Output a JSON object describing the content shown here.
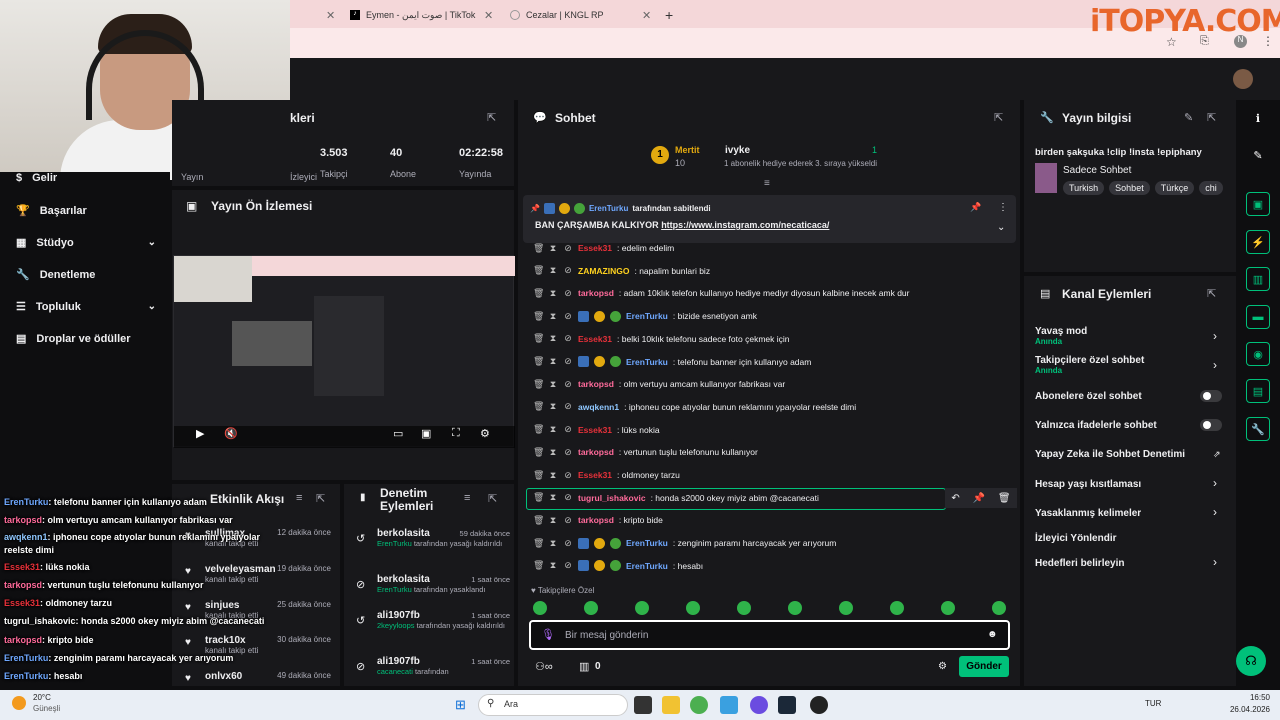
{
  "browser": {
    "tabs": [
      {
        "label": "Eymen - صوت ايمن | TikTok"
      },
      {
        "label": "Cezalar | KNGL RP"
      }
    ],
    "watermark": "iTOPYA.COM"
  },
  "sidebar": {
    "items": [
      {
        "label": "Gelir"
      },
      {
        "label": "Başarılar"
      },
      {
        "label": "Stüdyo"
      },
      {
        "label": "Denetleme"
      },
      {
        "label": "Topluluk"
      },
      {
        "label": "Droplar ve ödüller"
      }
    ]
  },
  "stats": {
    "title": "kleri",
    "items": [
      {
        "value": "3.503",
        "label": "Takipçi"
      },
      {
        "value": "40",
        "label": "Abone"
      },
      {
        "value": "02:22:58",
        "label": "Yayında"
      }
    ],
    "left_label": "Yayın",
    "left2": "İzleyici"
  },
  "preview": {
    "title": "Yayın Ön İzlemesi"
  },
  "activity": {
    "title": "Etkinlik Akışı",
    "items": [
      {
        "name": "sullimax",
        "text": "kanalı takip etti",
        "time": "12 dakika önce"
      },
      {
        "name": "velveleyasman",
        "text": "kanalı takip etti",
        "time": "19 dakika önce"
      },
      {
        "name": "sinjues",
        "text": "kanalı takip etti",
        "time": "25 dakika önce"
      },
      {
        "name": "track10x",
        "text": "kanalı takip etti",
        "time": "30 dakika önce"
      },
      {
        "name": "onlvx60",
        "text": "",
        "time": "49 dakika önce"
      }
    ]
  },
  "moderation": {
    "title": "Denetim Eylemleri",
    "items": [
      {
        "name": "berkolasita",
        "time": "59 dakika önce",
        "actor": "ErenTurku",
        "text": "tarafından yasağı kaldırıldı"
      },
      {
        "name": "berkolasita",
        "time": "1 saat önce",
        "actor": "ErenTurku",
        "text": "tarafından yasaklandı"
      },
      {
        "name": "ali1907fb",
        "time": "1 saat önce",
        "actor": "2keyyloops",
        "text": "tarafından yasağı kaldırıldı"
      },
      {
        "name": "ali1907fb",
        "time": "1 saat önce",
        "actor": "cacanecati",
        "text": "tarafından"
      }
    ]
  },
  "chat": {
    "title": "Sohbet",
    "gift": {
      "user1": "Mertit",
      "count1": "10",
      "user2": "ivyke",
      "count2": "1",
      "text": "1 abonelik hediye ederek 3. sıraya yükseldi"
    },
    "pinned": {
      "by": "ErenTurku",
      "by_text": "tarafından sabitlendi",
      "text": "BAN ÇARŞAMBA KALKIYOR",
      "link": "https://www.instagram.com/necaticaca/"
    },
    "messages": [
      {
        "user": "Essek31",
        "color": "#e8313a",
        "text": ": edelim edelim"
      },
      {
        "user": "ZAMAZINGO",
        "color": "#ffd21f",
        "text": ": napalim bunlari biz"
      },
      {
        "user": "tarkopsd",
        "color": "#ff6b9b",
        "text": ": adam 10klık telefon kullanıyo hediye mediyr diyosun kalbine inecek amk dur"
      },
      {
        "user": "ErenTurku",
        "color": "#6fa8ff",
        "text": ": bizide esnetiyon amk"
      },
      {
        "user": "Essek31",
        "color": "#e8313a",
        "text": ": belki 10klık telefonu sadece foto çekmek için"
      },
      {
        "user": "ErenTurku",
        "color": "#6fa8ff",
        "text": ": telefonu banner için kullanıyo adam"
      },
      {
        "user": "tarkopsd",
        "color": "#ff6b9b",
        "text": ": olm vertuyu amcam kullanıyor fabrikası var"
      },
      {
        "user": "awqkenn1",
        "color": "#8fc7ff",
        "text": ": iphoneu cope atıyolar bunun reklamını ypaıyolar reelste dimi"
      },
      {
        "user": "Essek31",
        "color": "#e8313a",
        "text": ": lüks nokia"
      },
      {
        "user": "tarkopsd",
        "color": "#ff6b9b",
        "text": ": vertunun tuşlu telefonunu kullanıyor"
      },
      {
        "user": "Essek31",
        "color": "#e8313a",
        "text": ": oldmoney tarzu"
      },
      {
        "user": "tugrul_ishakovic",
        "color": "#ff6b9b",
        "text": ": honda s2000 okey miyiz abim @cacanecati"
      },
      {
        "user": "tarkopsd",
        "color": "#ff6b9b",
        "text": ": kripto bide"
      },
      {
        "user": "ErenTurku",
        "color": "#6fa8ff",
        "text": ": zenginim paramı harcayacak yer arıyorum"
      },
      {
        "user": "ErenTurku",
        "color": "#6fa8ff",
        "text": ": hesabı"
      }
    ],
    "followers_only": "Takipçilere Özel",
    "input_placeholder": "Bir mesaj gönderin",
    "count": "0",
    "send": "Gönder"
  },
  "overlay": [
    {
      "user": "ErenTurku",
      "color": "#6fa8ff",
      "text": ": telefonu banner için kullanıyo adam"
    },
    {
      "user": "tarkopsd",
      "color": "#ff6b9b",
      "text": ": olm vertuyu amcam kullanıyor fabrikası var"
    },
    {
      "user": "awqkenn1",
      "color": "#8fc7ff",
      "text": ": iphoneu cope atıyolar bunun reklamını ypaıyolar"
    },
    {
      "user": "",
      "color": "#fff",
      "text": "reelste dimi"
    },
    {
      "user": "Essek31",
      "color": "#e8313a",
      "text": ": lüks nokia"
    },
    {
      "user": "tarkopsd",
      "color": "#ff6b9b",
      "text": ": vertunun tuşlu telefonunu kullanıyor"
    },
    {
      "user": "Essek31",
      "color": "#e8313a",
      "text": ": oldmoney tarzu"
    },
    {
      "user": "tugrul_ishakovic",
      "color": "#fff",
      "text": ": honda s2000 okey miyiz abim @cacanecati"
    },
    {
      "user": "tarkopsd",
      "color": "#ff6b9b",
      "text": ": kripto bide"
    },
    {
      "user": "ErenTurku",
      "color": "#6fa8ff",
      "text": ": zenginim paramı harcayacak yer arıyorum"
    },
    {
      "user": "ErenTurku",
      "color": "#6fa8ff",
      "text": ": hesabı"
    }
  ],
  "stream_info": {
    "title": "Yayın bilgisi",
    "stream_title": "birden şakşuka !clip !insta !epiphany",
    "category": "Sadece Sohbet",
    "tags": [
      "Turkish",
      "Sohbet",
      "Türkçe",
      "chi"
    ]
  },
  "channel_actions": {
    "title": "Kanal Eylemleri",
    "items": [
      {
        "label": "Yavaş mod",
        "sub": "Anında",
        "kind": "arrow"
      },
      {
        "label": "Takipçilere özel sohbet",
        "sub": "Anında",
        "kind": "arrow"
      },
      {
        "label": "Abonelere özel sohbet",
        "sub": "",
        "kind": "toggle"
      },
      {
        "label": "Yalnızca ifadelerle sohbet",
        "sub": "",
        "kind": "toggle"
      },
      {
        "label": "Yapay Zeka ile Sohbet Denetimi",
        "sub": "",
        "kind": "ext"
      },
      {
        "label": "Hesap yaşı kısıtlaması",
        "sub": "",
        "kind": "arrow"
      },
      {
        "label": "Yasaklanmış kelimeler",
        "sub": "",
        "kind": "arrow"
      },
      {
        "label": "İzleyici Yönlendir",
        "sub": "",
        "kind": "none"
      },
      {
        "label": "Hedefleri belirleyin",
        "sub": "",
        "kind": "arrow"
      }
    ]
  },
  "taskbar": {
    "weather_temp": "20°C",
    "weather_desc": "Güneşli",
    "search": "Ara",
    "lang": "TUR",
    "time": "16:50",
    "date": "26.04.2026"
  }
}
